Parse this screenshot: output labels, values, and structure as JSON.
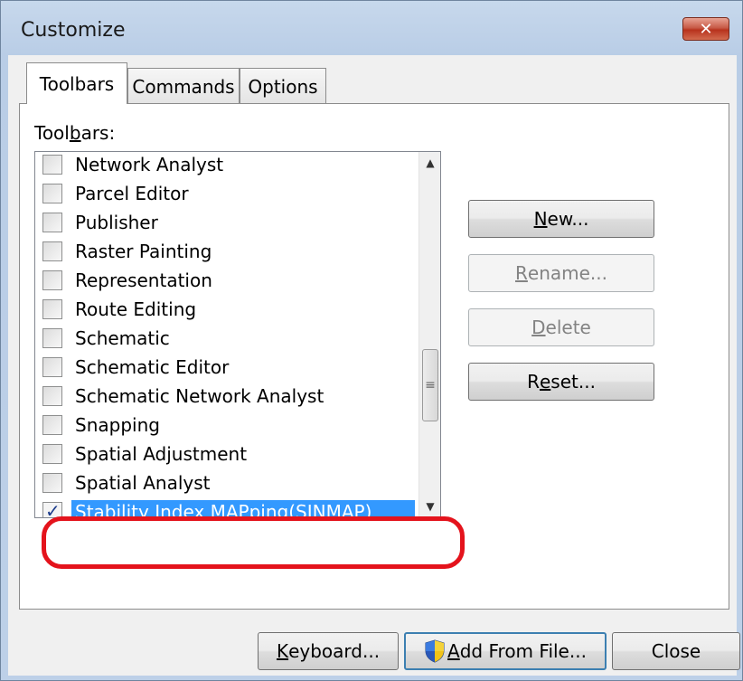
{
  "window": {
    "title": "Customize",
    "close_glyph": "✕"
  },
  "tabs": [
    {
      "label": "Toolbars",
      "active": true
    },
    {
      "label": "Commands",
      "active": false
    },
    {
      "label": "Options",
      "active": false
    }
  ],
  "toolbars_panel": {
    "list_label_pre": "Tool",
    "list_label_mnemonic": "b",
    "list_label_post": "ars:",
    "items": [
      {
        "label": "Network Analyst",
        "checked": false
      },
      {
        "label": "Parcel Editor",
        "checked": false
      },
      {
        "label": "Publisher",
        "checked": false
      },
      {
        "label": "Raster Painting",
        "checked": false
      },
      {
        "label": "Representation",
        "checked": false
      },
      {
        "label": "Route Editing",
        "checked": false
      },
      {
        "label": "Schematic",
        "checked": false
      },
      {
        "label": "Schematic Editor",
        "checked": false
      },
      {
        "label": "Schematic Network Analyst",
        "checked": false
      },
      {
        "label": "Snapping",
        "checked": false
      },
      {
        "label": "Spatial Adjustment",
        "checked": false
      },
      {
        "label": "Spatial Analyst",
        "checked": false
      },
      {
        "label": "Stability Index MAPping(SINMAP)",
        "checked": true,
        "selected": true
      }
    ],
    "buttons": {
      "new": {
        "mnemonic": "N",
        "rest": "ew...",
        "enabled": true
      },
      "rename": {
        "mnemonic": "R",
        "rest": "ename...",
        "enabled": false
      },
      "delete": {
        "mnemonic": "D",
        "rest": "elete",
        "enabled": false
      },
      "reset": {
        "pre": "R",
        "mnemonic": "e",
        "rest": "set...",
        "enabled": true
      }
    }
  },
  "footer": {
    "keyboard": {
      "mnemonic": "K",
      "rest": "eyboard..."
    },
    "add_from_file": {
      "mnemonic": "A",
      "rest": "dd From File..."
    },
    "close": "Close"
  },
  "colors": {
    "selection": "#3399ff",
    "annotation_ring": "#e4131c"
  }
}
